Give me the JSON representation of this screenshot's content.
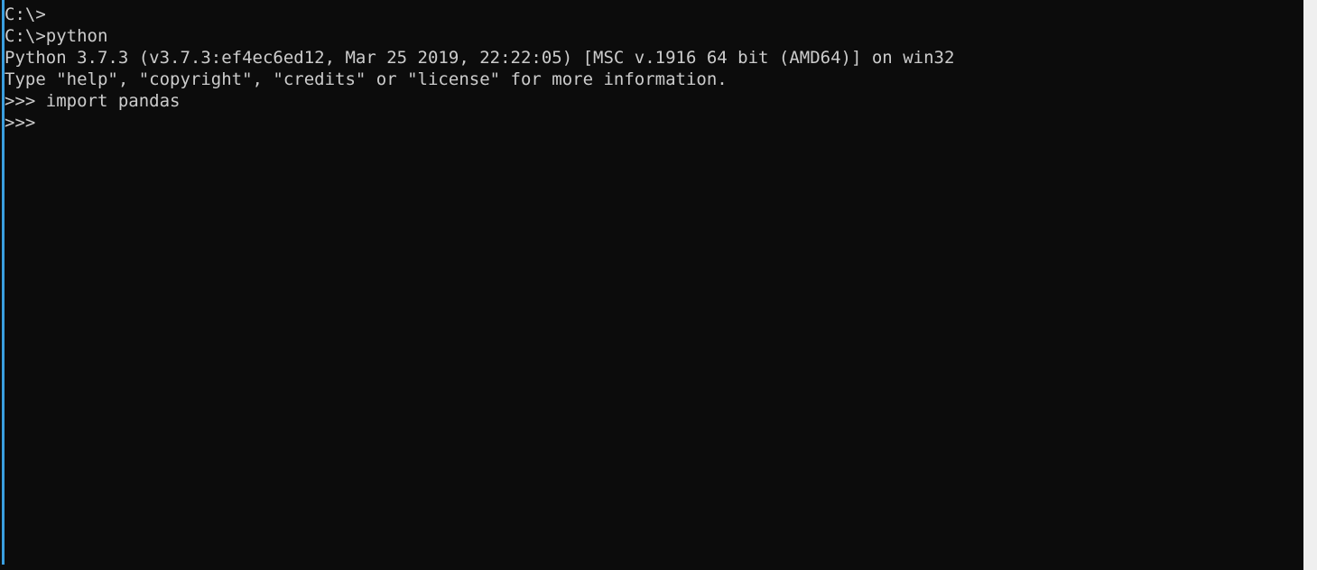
{
  "window": {
    "type": "windows-command-prompt",
    "background_color": "#0c0c0c",
    "text_color": "#cccccc",
    "accent_color": "#3a9fe0",
    "desktop_color": "#efefef"
  },
  "terminal": {
    "lines": [
      {
        "text": "C:\\>",
        "kind": "prompt"
      },
      {
        "text": "C:\\>python",
        "kind": "command"
      },
      {
        "text": "Python 3.7.3 (v3.7.3:ef4ec6ed12, Mar 25 2019, 22:22:05) [MSC v.1916 64 bit (AMD64)] on win32",
        "kind": "output"
      },
      {
        "text": "Type \"help\", \"copyright\", \"credits\" or \"license\" for more information.",
        "kind": "output"
      },
      {
        "text": ">>> import pandas",
        "kind": "repl-command"
      },
      {
        "text": ">>>",
        "kind": "repl-prompt"
      }
    ]
  }
}
